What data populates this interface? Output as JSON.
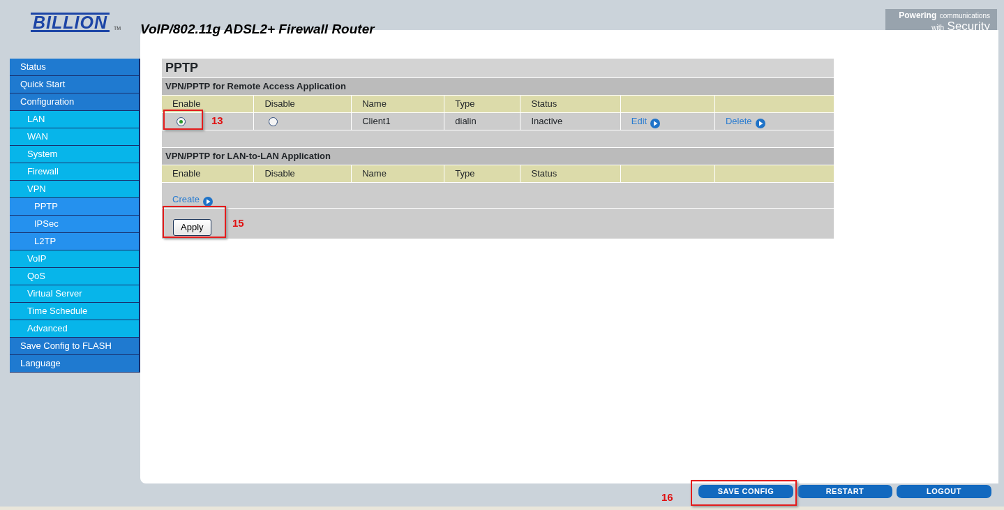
{
  "header": {
    "logo": "BILLION",
    "trademark": "TM",
    "title": "VoIP/802.11g ADSL2+ Firewall Router",
    "tagline": [
      [
        "Powering",
        "communications"
      ],
      [
        "with",
        "Security"
      ]
    ]
  },
  "sidebar": {
    "items": [
      {
        "label": "Status"
      },
      {
        "label": "Quick Start"
      },
      {
        "label": "Configuration",
        "children": [
          {
            "label": "LAN"
          },
          {
            "label": "WAN"
          },
          {
            "label": "System"
          },
          {
            "label": "Firewall"
          },
          {
            "label": "VPN",
            "children": [
              {
                "label": "PPTP"
              },
              {
                "label": "IPSec"
              },
              {
                "label": "L2TP"
              }
            ]
          },
          {
            "label": "VoIP"
          },
          {
            "label": "QoS"
          },
          {
            "label": "Virtual Server"
          },
          {
            "label": "Time Schedule"
          },
          {
            "label": "Advanced"
          }
        ]
      },
      {
        "label": "Save Config to FLASH"
      },
      {
        "label": "Language"
      }
    ]
  },
  "page_title": "PPTP",
  "remote_access": {
    "title": "VPN/PPTP for Remote Access Application",
    "columns": [
      "Enable",
      "Disable",
      "Name",
      "Type",
      "Status"
    ],
    "rows": [
      {
        "enable": {
          "selected": true
        },
        "disable": {
          "selected": false
        },
        "name": "Client1",
        "type": "dialin",
        "status": "Inactive",
        "edit": "Edit",
        "delete": "Delete"
      }
    ]
  },
  "lan_to_lan": {
    "title": "VPN/PPTP for LAN-to-LAN Application",
    "columns": [
      "Enable",
      "Disable",
      "Name",
      "Type",
      "Status"
    ],
    "create": "Create"
  },
  "apply_button": "Apply",
  "footer_buttons": [
    "SAVE CONFIG",
    "RESTART",
    "LOGOUT"
  ],
  "annotations": [
    "13",
    "15",
    "16"
  ]
}
